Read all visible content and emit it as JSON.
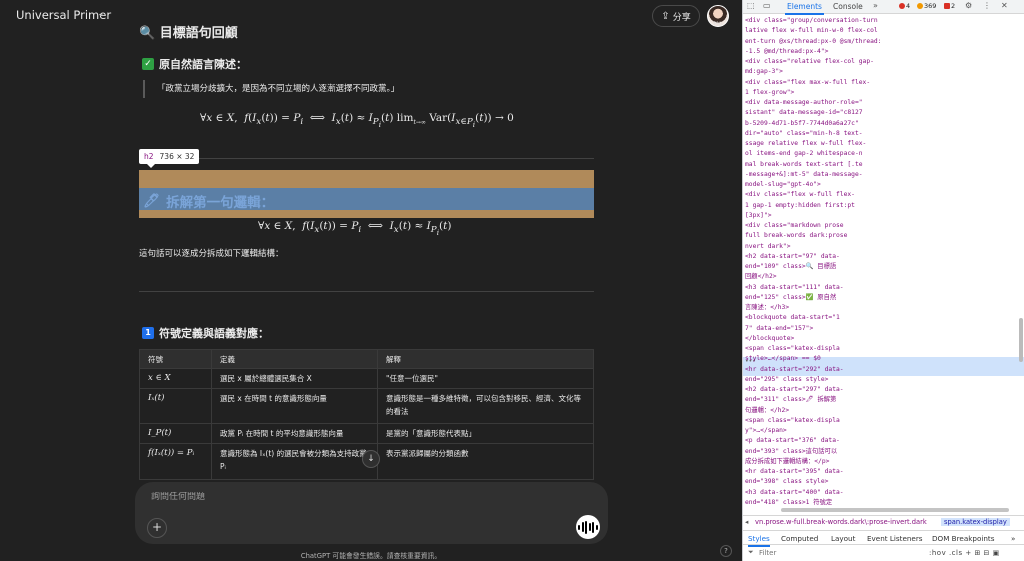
{
  "header": {
    "model_name": "Universal Primer",
    "share_label": "分享",
    "avatar_caption": "利心"
  },
  "article": {
    "top_heading": "🔍 目標語句回顧",
    "section1_title": "原自然語言陳述：",
    "quote_text": "「政黨立場分歧擴大，是因為不同立場的人逐漸選擇不同政黨。」",
    "section2_title": "拆解第一句邏輯：",
    "paragraph": "這句話可以逐成分拆成如下邏輯結構：",
    "section3_title": "符號定義與語義對應：",
    "section3_icon": "1"
  },
  "tooltip": {
    "tag": "h2",
    "size": "736 × 32"
  },
  "table": {
    "headers": [
      "符號",
      "定義",
      "解釋"
    ],
    "rows": [
      [
        "x ∈ X",
        "選民 x 屬於總體選民集合 X",
        "\"任意一位選民\""
      ],
      [
        "Iₓ(t)",
        "選民 x 在時間 t 的意識形態向量",
        "意識形態是一種多維特徵，可以包含對移民、經濟、文化等的看法"
      ],
      [
        "I_P(t)",
        "政黨 Pᵢ 在時間 t 的平均意識形態向量",
        "是黨的「意識形態代表點」"
      ],
      [
        "f(Iₓ(t)) = Pᵢ",
        "意識形態為 Iₓ(t) 的選民會被分類為支持政黨 Pᵢ",
        "表示黨派歸屬的分類函數"
      ]
    ]
  },
  "composer": {
    "placeholder": "詢問任何問題",
    "plus_label": "+"
  },
  "disclaimer": "ChatGPT 可能會發生錯誤。請查核重要資訊。",
  "help_label": "?",
  "devtools": {
    "tabs": [
      "Elements",
      "Console"
    ],
    "active_tab": "Elements",
    "errors": "4",
    "warnings": "369",
    "issues": "2",
    "dom_lines": [
      "<div class=\"group/conversation-turn",
      "lative flex w-full min-w-0 flex-col",
      "ent-turn @xs/thread:px-0 @sm/thread:",
      "-1.5 @md/thread:px-4\">",
      "<div class=\"relative flex-col gap-",
      "md:gap-3\">",
      "<div class=\"flex max-w-full flex-",
      "1 flex-grow\">",
      "<div data-message-author-role=\"",
      "sistant\" data-message-id=\"c8127",
      "b-5209-4d71-b5f7-7744d0a6a27c\"",
      "dir=\"auto\" class=\"min-h-8 text-",
      "ssage relative flex w-full flex-",
      "ol items-end gap-2 whitespace-n",
      "mal break-words text-start [.te",
      "-message+&]:mt-5\" data-message-",
      "model-slug=\"gpt-4o\">",
      "<div class=\"flex w-full flex-",
      "1 gap-1 empty:hidden first:pt",
      "[3px]\">",
      "<div class=\"markdown prose",
      "full break-words dark:prose",
      "nvert dark\">",
      "<h2 data-start=\"97\" data-",
      "end=\"109\" class>🔍 目標語",
      "回顧</h2>",
      "<h3 data-start=\"111\" data-",
      "end=\"125\" class>✅ 原自然",
      "言陳述：</h3>",
      "<blockquote data-start=\"1",
      "7\" data-end=\"157\">",
      "</blockquote>",
      "<span class=\"katex-displa",
      "style>…</span> == $0",
      "<hr data-start=\"292\" data-",
      "end=\"295\" class style>",
      "<h2 data-start=\"297\" data-",
      "end=\"311\" class>🖊 拆解第",
      "句邏輯：</h2>",
      "<span class=\"katex-displa",
      "y\">…</span>",
      "<p data-start=\"376\" data-",
      "end=\"393\" class>這句話可以",
      "成分拆成如下邏輯結構：</p>",
      "<hr data-start=\"395\" data-",
      "end=\"398\" class style>",
      "<h3 data-start=\"400\" data-",
      "end=\"418\" class>1 符號定"
    ],
    "breadcrumb_path": "vn.prose.w-full.break-words.dark\\:prose-invert.dark",
    "breadcrumb_selected": "span.katex-display",
    "panel_tabs": [
      "Styles",
      "Computed",
      "Layout",
      "Event Listeners",
      "DOM Breakpoints"
    ],
    "filter_placeholder": "Filter",
    "filter_tools": ":hov .cls"
  }
}
